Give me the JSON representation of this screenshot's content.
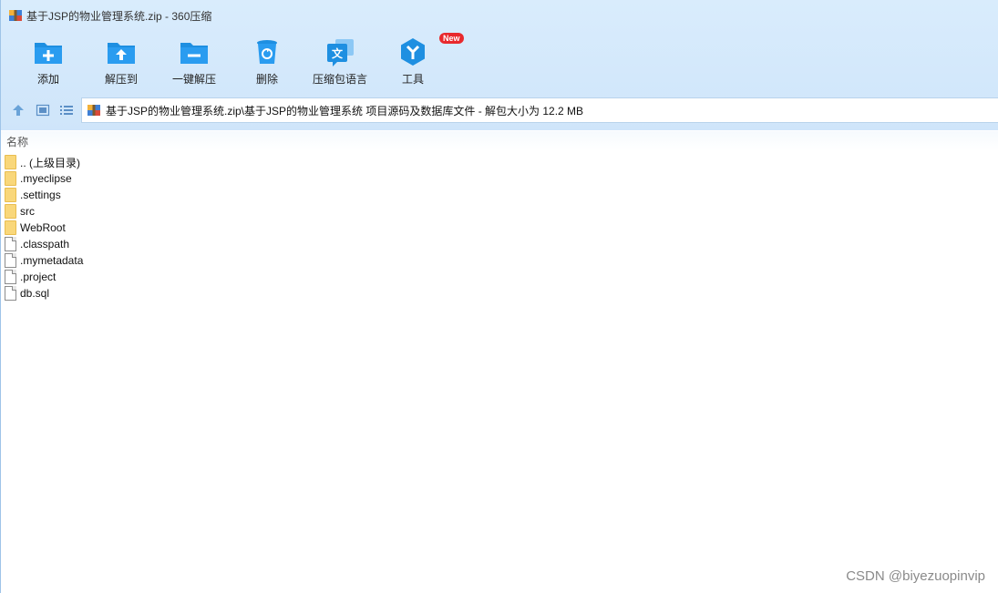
{
  "window": {
    "title": "基于JSP的物业管理系统.zip - 360压缩"
  },
  "toolbar": {
    "items": [
      {
        "label": "添加",
        "icon": "folder-add-icon"
      },
      {
        "label": "解压到",
        "icon": "folder-extract-icon"
      },
      {
        "label": "一键解压",
        "icon": "folder-quick-extract-icon"
      },
      {
        "label": "删除",
        "icon": "trash-icon"
      },
      {
        "label": "压缩包语言",
        "icon": "language-icon"
      },
      {
        "label": "工具",
        "icon": "tools-icon",
        "badge": "New"
      }
    ]
  },
  "address": {
    "path": "基于JSP的物业管理系统.zip\\基于JSP的物业管理系统 项目源码及数据库文件 - 解包大小为 12.2 MB"
  },
  "list": {
    "column_name": "名称",
    "items": [
      {
        "name": ".. (上级目录)",
        "type": "folder"
      },
      {
        "name": ".myeclipse",
        "type": "folder"
      },
      {
        "name": ".settings",
        "type": "folder"
      },
      {
        "name": "src",
        "type": "folder"
      },
      {
        "name": "WebRoot",
        "type": "folder"
      },
      {
        "name": ".classpath",
        "type": "file"
      },
      {
        "name": ".mymetadata",
        "type": "file"
      },
      {
        "name": ".project",
        "type": "file"
      },
      {
        "name": "db.sql",
        "type": "file"
      }
    ]
  },
  "watermark": "CSDN @biyezuopinvip",
  "colors": {
    "accent": "#1e8fe1",
    "toolbar_bg": "#d6eafb",
    "badge": "#e8292d",
    "folder": "#f9d77a"
  }
}
